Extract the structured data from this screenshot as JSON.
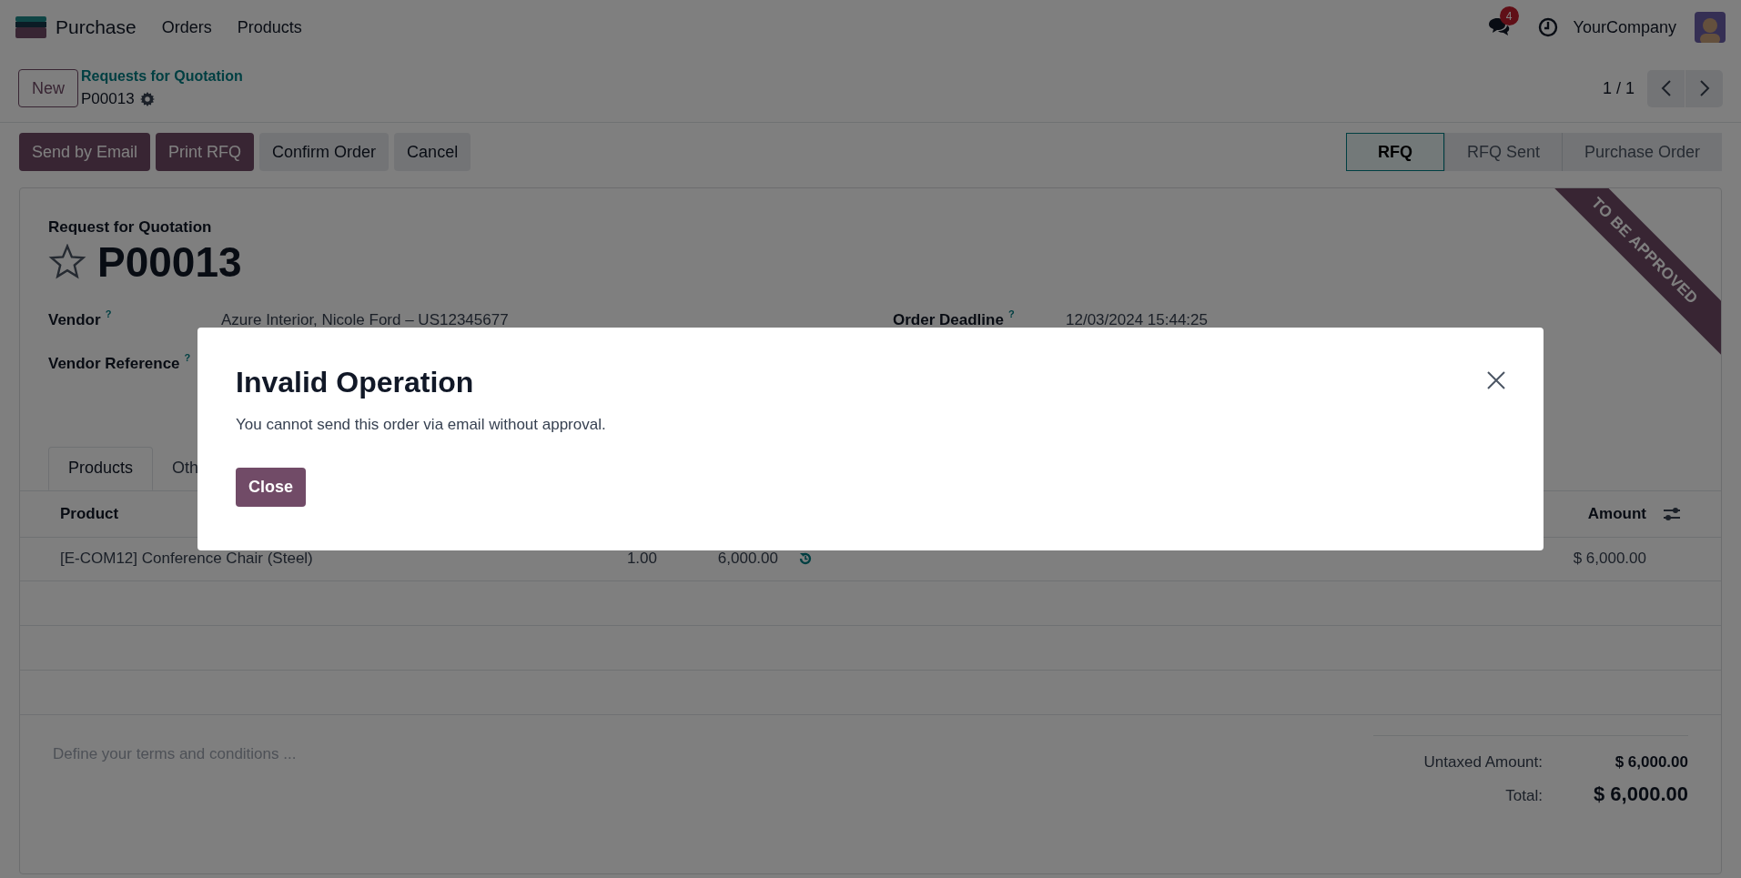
{
  "navbar": {
    "app": "Purchase",
    "menu": [
      "Orders",
      "Products"
    ],
    "messages_badge": "4",
    "company": "YourCompany"
  },
  "control_panel": {
    "new_button": "New",
    "breadcrumb": "Requests for Quotation",
    "record": "P00013",
    "pager": "1 / 1"
  },
  "actions": [
    {
      "label": "Send by Email",
      "kind": "primary"
    },
    {
      "label": "Print RFQ",
      "kind": "primary"
    },
    {
      "label": "Confirm Order",
      "kind": "secondary"
    },
    {
      "label": "Cancel",
      "kind": "secondary"
    }
  ],
  "status_steps": [
    {
      "label": "RFQ",
      "selected": true
    },
    {
      "label": "RFQ Sent",
      "selected": false
    },
    {
      "label": "Purchase Order",
      "selected": false
    }
  ],
  "ribbon": "TO BE APPROVED",
  "form": {
    "subtitle": "Request for Quotation",
    "name": "P00013",
    "starred": false,
    "left_fields": [
      {
        "label": "Vendor",
        "help": "?",
        "value": "Azure Interior, Nicole Ford – US12345677"
      },
      {
        "label": "Vendor Reference",
        "help": "?"
      }
    ],
    "right_fields": [
      {
        "label": "Order Deadline",
        "help": "?",
        "value": "12/03/2024 15:44:25"
      }
    ]
  },
  "tabs": [
    {
      "label": "Products",
      "selected": true
    },
    {
      "label": "Oth",
      "selected": false
    }
  ],
  "table": {
    "columns": {
      "product": "Product",
      "amount": "Amount"
    },
    "rows": [
      {
        "product": "[E-COM12] Conference Chair (Steel)",
        "quantity": "1.00",
        "unit_price": "6,000.00",
        "amount": "$ 6,000.00"
      }
    ]
  },
  "notes": {
    "placeholder": "Define your terms and conditions ..."
  },
  "totals": {
    "untaxed_label": "Untaxed Amount:",
    "untaxed": "$ 6,000.00",
    "total_label": "Total:",
    "total": "$ 6,000.00"
  },
  "dialog": {
    "title": "Invalid Operation",
    "message": "You cannot send this order via email without approval.",
    "button": "Close"
  }
}
